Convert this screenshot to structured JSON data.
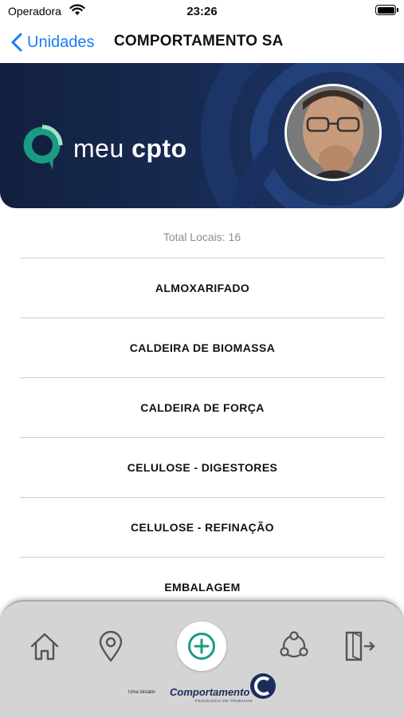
{
  "status": {
    "carrier": "Operadora",
    "time": "23:26"
  },
  "nav": {
    "back_label": "Unidades",
    "title": "COMPORTAMENTO SA"
  },
  "banner": {
    "logo_text_light": "meu",
    "logo_text_bold": "cpto"
  },
  "content": {
    "total_label": "Total Locais: 16",
    "locais": [
      "ALMOXARIFADO",
      "CALDEIRA DE BIOMASSA",
      "CALDEIRA DE FORÇA",
      "CELULOSE - DIGESTORES",
      "CELULOSE - REFINAÇÃO",
      "EMBALAGEM"
    ]
  },
  "tabbar": {
    "icons": [
      "home-icon",
      "location-pin-icon",
      "add-circle-icon",
      "share-network-icon",
      "logout-icon"
    ],
    "initiative_text": "Uma iniciativ",
    "brand_name": "Comportamento",
    "brand_sub": "PSICOLOGIA DO TRABALHO"
  },
  "colors": {
    "accent": "#1a7cf5",
    "banner": "#12203f",
    "teal": "#1a9b82",
    "tabbar": "#d4d4d4"
  }
}
